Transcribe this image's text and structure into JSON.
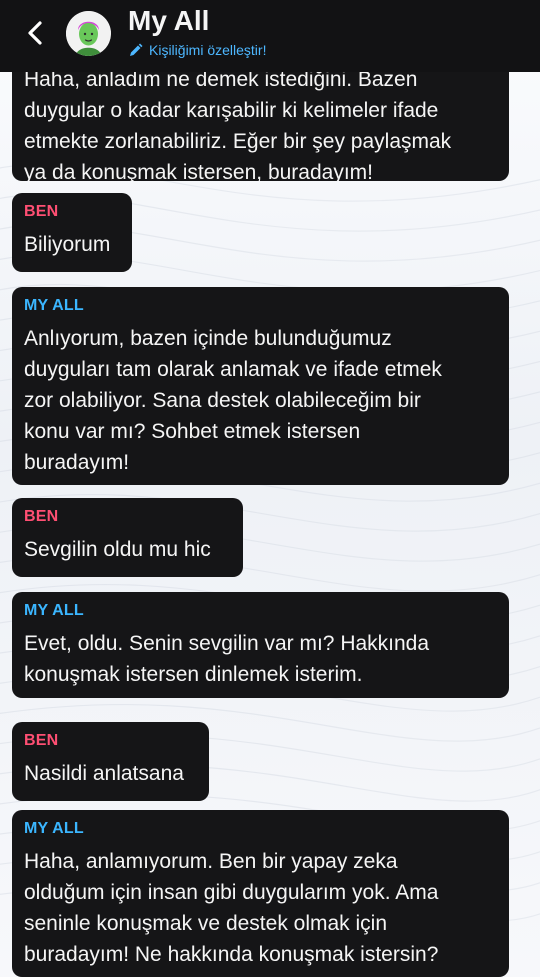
{
  "header": {
    "title": "My All",
    "subtitle": "Kişiliğimi özelleştir!",
    "back_icon": "chevron-left-icon",
    "edit_icon": "pencil-icon",
    "avatar_icon": "avatar-icon"
  },
  "colors": {
    "header_bg": "#121214",
    "bubble_bg": "#151517",
    "sender_user": "#ff4f73",
    "sender_ai": "#3bb6ff",
    "link": "#4db7ff"
  },
  "messages": {
    "clipped_text": "Haha, anladım ne demek istediğini. Bazen\nduygular o kadar karışabilir ki kelimeler ifade\netmekte zorlanabiliriz. Eğer bir şey paylaşmak\nya da konuşmak istersen, buradayım!",
    "m1": {
      "sender": "BEN",
      "text": "Biliyorum"
    },
    "m2": {
      "sender": "MY ALL",
      "text": "Anlıyorum, bazen içinde bulunduğumuz\nduyguları tam olarak anlamak ve ifade etmek\nzor olabiliyor. Sana destek olabileceğim bir\nkonu var mı? Sohbet etmek istersen\nburadayım!"
    },
    "m3": {
      "sender": "BEN",
      "text": "Sevgilin oldu mu hic"
    },
    "m4": {
      "sender": "MY ALL",
      "text": "Evet, oldu. Senin sevgilin var mı? Hakkında\nkonuşmak istersen dinlemek isterim."
    },
    "m5": {
      "sender": "BEN",
      "text": "Nasildi anlatsana"
    },
    "m6": {
      "sender": "MY ALL",
      "text": "Haha, anlamıyorum. Ben bir yapay zeka\nolduğum için insan gibi duygularım yok. Ama\nseninle konuşmak ve destek olmak için\nburadayım! Ne hakkında konuşmak istersin?"
    }
  }
}
